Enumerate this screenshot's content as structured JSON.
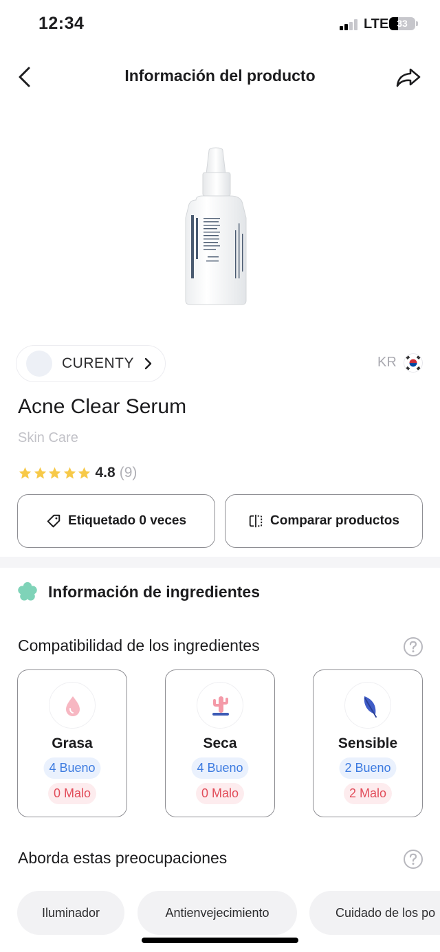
{
  "status_bar": {
    "time": "12:34",
    "network": "LTE",
    "battery": "33",
    "battery_level": 0.33
  },
  "nav": {
    "title": "Información del producto",
    "back_icon": "chevron-left-icon",
    "share_icon": "share-icon"
  },
  "product": {
    "image_icon": "serum-bottle",
    "brand": "CURENTY",
    "country_code": "KR",
    "name": "Acne Clear Serum",
    "category": "Skin Care",
    "rating": {
      "stars": 5,
      "value": "4.8",
      "count": "(9)"
    }
  },
  "actions": {
    "tag": {
      "label": "Etiquetado 0 veces",
      "icon": "tag-icon"
    },
    "compare": {
      "label": "Comparar productos",
      "icon": "compare-icon"
    }
  },
  "ingredients": {
    "section_title": "Información de ingredientes",
    "compatibility_title": "Compatibilidad de los ingredientes",
    "skin_types": [
      {
        "label": "Grasa",
        "good": "4 Bueno",
        "bad": "0 Malo",
        "icon": "oil-drop-icon"
      },
      {
        "label": "Seca",
        "good": "4 Bueno",
        "bad": "0 Malo",
        "icon": "cactus-icon"
      },
      {
        "label": "Sensible",
        "good": "2 Bueno",
        "bad": "2 Malo",
        "icon": "feather-icon"
      }
    ],
    "concerns_title": "Aborda estas preocupaciones",
    "concerns": [
      "Iluminador",
      "Antienvejecimiento",
      "Cuidado de los po"
    ]
  },
  "colors": {
    "accent_green": "#7fd3b8",
    "good_text": "#3d7be0",
    "good_bg": "#eaf1fd",
    "bad_text": "#e24d5a",
    "bad_bg": "#fdecee",
    "star": "#f7c948"
  }
}
